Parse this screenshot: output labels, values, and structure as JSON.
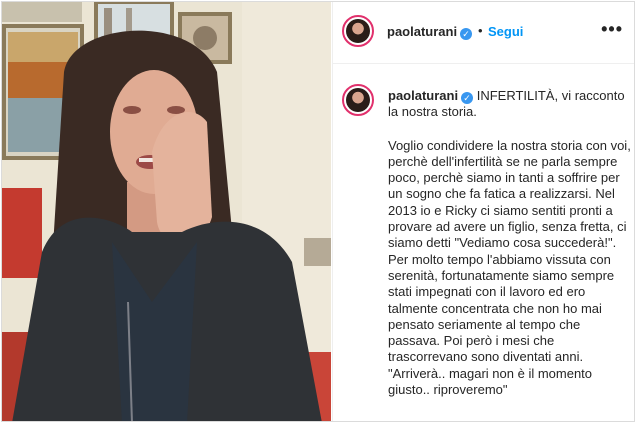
{
  "post": {
    "username": "paolaturani",
    "follow_label": "Segui",
    "dot": "•",
    "more_label": "•••",
    "verified_glyph": "✓",
    "caption_title": "INFERTILITÀ, vi racconto la nostra storia.",
    "caption_body": "Voglio condividere la nostra storia con voi, perchè dell'infertilità se ne parla sempre poco, perchè siamo in tanti a soffrire per un sogno che fa fatica a realizzarsi. Nel 2013 io e Ricky ci siamo sentiti pronti a provare ad avere un figlio, senza fretta, ci siamo detti \"Vediamo cosa succederà!\". Per molto tempo l'abbiamo vissuta con serenità, fortunatamente siamo sempre stati impegnati con il lavoro ed ero talmente concentrata che non ho mai pensato seriamente al tempo che passava. Poi però i mesi che trascorrevano sono diventati anni. \"Arriverà.. magari non è il momento giusto.. riproveremo\""
  },
  "colors": {
    "accent": "#0095f6",
    "verified": "#3897f0",
    "avatar_ring": "#e1306c",
    "text": "#262626"
  },
  "icons": {
    "verified": "verified-badge-icon",
    "more": "more-options-icon"
  }
}
